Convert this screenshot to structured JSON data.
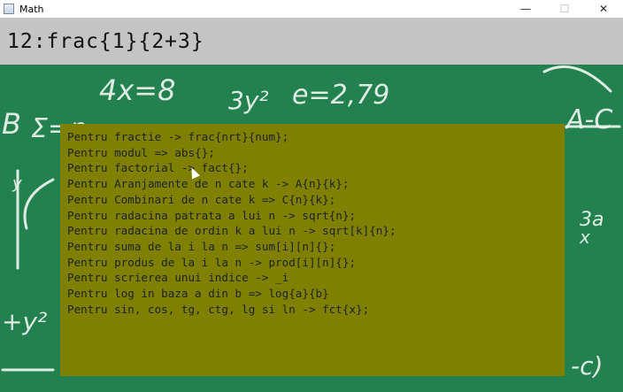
{
  "window": {
    "title": "Math",
    "minimize_glyph": "—",
    "maximize_glyph": "☐",
    "close_glyph": "✕"
  },
  "expression": {
    "value": "12:frac{1}{2+3}"
  },
  "background": {
    "board_color": "#23804f",
    "chalk_color": "#eef5ef",
    "formulas": [
      "4x=8",
      "3y²",
      "e=2,79",
      "Σ=n",
      "A-C",
      "3a",
      "x",
      "+y²",
      "-c)",
      "y",
      "B"
    ]
  },
  "help": {
    "panel_color": "#7f7f00",
    "lines": [
      "Pentru fractie -> frac{nrt}{num};",
      "Pentru modul => abs{};",
      "Pentru factorial -> fact{};",
      "Pentru Aranjamente de n cate k -> A{n}{k};",
      "Pentru Combinari de n cate k => C{n}{k};",
      "Pentru radacina patrata a lui n -> sqrt{n};",
      "Pentru radacina de ordin k a lui n -> sqrt[k]{n};",
      "Pentru suma de la i la n => sum[i][n]{};",
      "Pentru produs de la i la n -> prod[i][n]{};",
      "Pentru scrierea unui indice -> _i",
      "Pentru log in baza a din b => log{a}{b}",
      "Pentru sin, cos, tg, ctg, lg si ln -> fct{x};"
    ]
  }
}
